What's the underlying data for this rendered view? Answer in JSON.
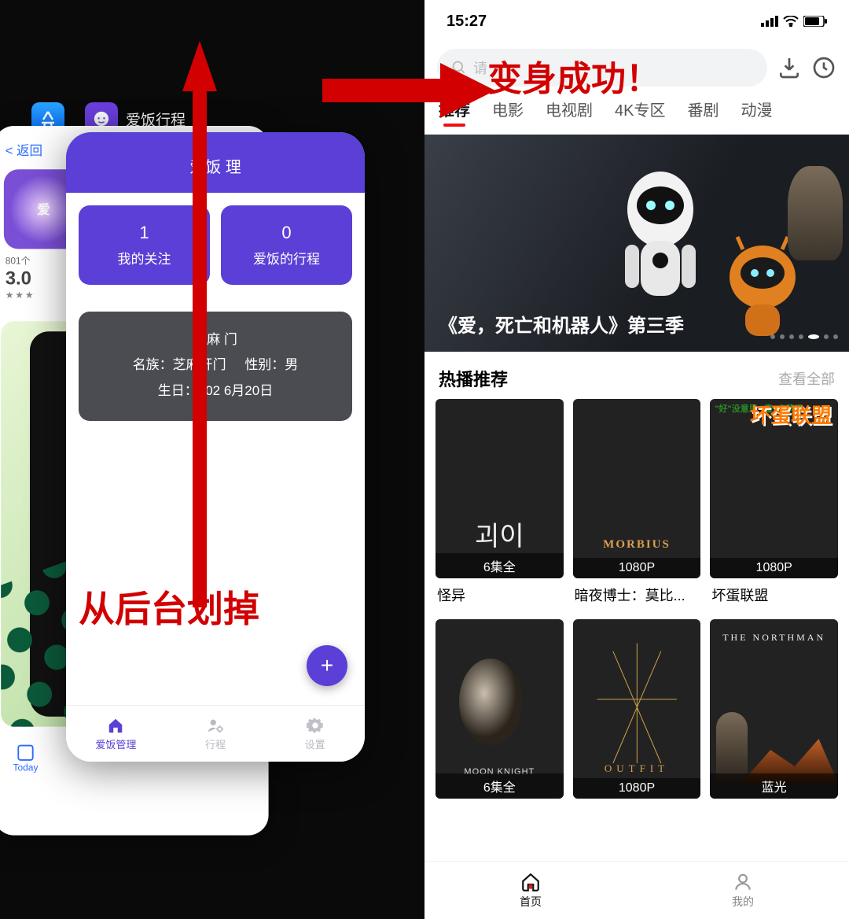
{
  "annotations": {
    "swipe_away": "从后台划掉",
    "transform_success": "变身成功！"
  },
  "left": {
    "switcher": {
      "app_name": "爱饭行程",
      "back_card": {
        "back_label": "返回",
        "avatar_text": "爱",
        "rating_count": "801个",
        "rating_value": "3.0",
        "stars": "★★★",
        "today_tab": "Today"
      },
      "front_card": {
        "header_title": "爱饭  理",
        "stats": [
          {
            "num": "1",
            "label": "我的关注"
          },
          {
            "num": "0",
            "label": "爱饭的行程"
          }
        ],
        "info": {
          "name": "芝麻  门",
          "line2_left": "名族：芝麻开门",
          "line2_right": "性别：男",
          "line3": "生日：202  6月20日"
        },
        "fab": "+",
        "tabs": [
          {
            "label": "爱饭管理",
            "active": true
          },
          {
            "label": "行程",
            "active": false
          },
          {
            "label": "设置",
            "active": false
          }
        ]
      }
    }
  },
  "right": {
    "status": {
      "time": "15:27"
    },
    "search": {
      "placeholder": "请"
    },
    "categories": [
      "推荐",
      "电影",
      "电视剧",
      "4K专区",
      "番剧",
      "动漫"
    ],
    "banner": {
      "title": "《爱，死亡和机器人》第三季"
    },
    "section": {
      "title": "热播推荐",
      "more": "查看全部"
    },
    "posters_row1": [
      {
        "badge": "6集全",
        "title": "怪异",
        "hint": "괴이"
      },
      {
        "badge": "1080P",
        "title": "暗夜博士：莫比...",
        "hint": "MORBIUS"
      },
      {
        "badge": "1080P",
        "title": "坏蛋联盟",
        "hint": "坏蛋联盟",
        "top": "\"好\"没意思 \"畫\"点萌吧"
      }
    ],
    "posters_row2": [
      {
        "badge": "6集全",
        "title": "",
        "hint": "MOON KNIGHT"
      },
      {
        "badge": "1080P",
        "title": "",
        "hint": "OUTFIT"
      },
      {
        "badge": "蓝光",
        "title": "",
        "hint": "THE NORTHMAN"
      }
    ],
    "bottom_nav": [
      {
        "label": "首页",
        "active": true
      },
      {
        "label": "我的",
        "active": false
      }
    ]
  }
}
